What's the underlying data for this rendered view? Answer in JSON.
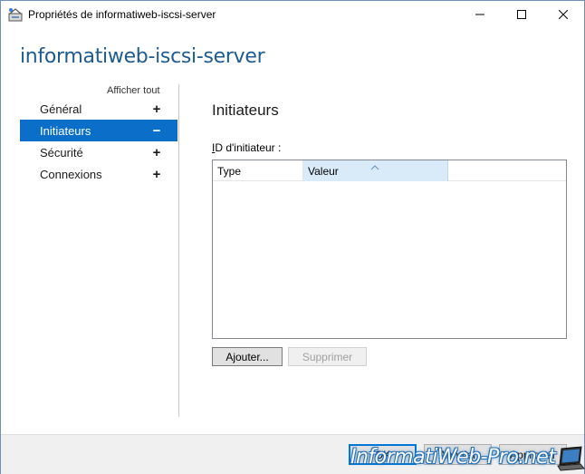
{
  "window": {
    "title": "Propriétés de informatiweb-iscsi-server",
    "minimize_icon": "minimize-icon",
    "maximize_icon": "maximize-icon",
    "close_icon": "close-icon"
  },
  "header": {
    "server_name": "informatiweb-iscsi-server"
  },
  "nav": {
    "show_all": "Afficher tout",
    "items": [
      {
        "label": "Général",
        "sign": "+"
      },
      {
        "label": "Initiateurs",
        "sign": "−",
        "active": true
      },
      {
        "label": "Sécurité",
        "sign": "+"
      },
      {
        "label": "Connexions",
        "sign": "+"
      }
    ]
  },
  "content": {
    "section_title": "Initiateurs",
    "field_label_prefix": "I",
    "field_label_rest": "D d'initiateur :",
    "list": {
      "columns": [
        "Type",
        "Valeur"
      ],
      "rows": []
    },
    "add_button": "Ajouter...",
    "remove_button": "Supprimer"
  },
  "footer": {
    "ok": "OK",
    "cancel": "Annuler",
    "apply": "Appliquer"
  },
  "watermark": {
    "text": "InformatiWeb-Pro.net"
  },
  "colors": {
    "accent": "#0b6fc9",
    "title_blue": "#1e5b91",
    "selected_column": "#d9ebf9"
  }
}
